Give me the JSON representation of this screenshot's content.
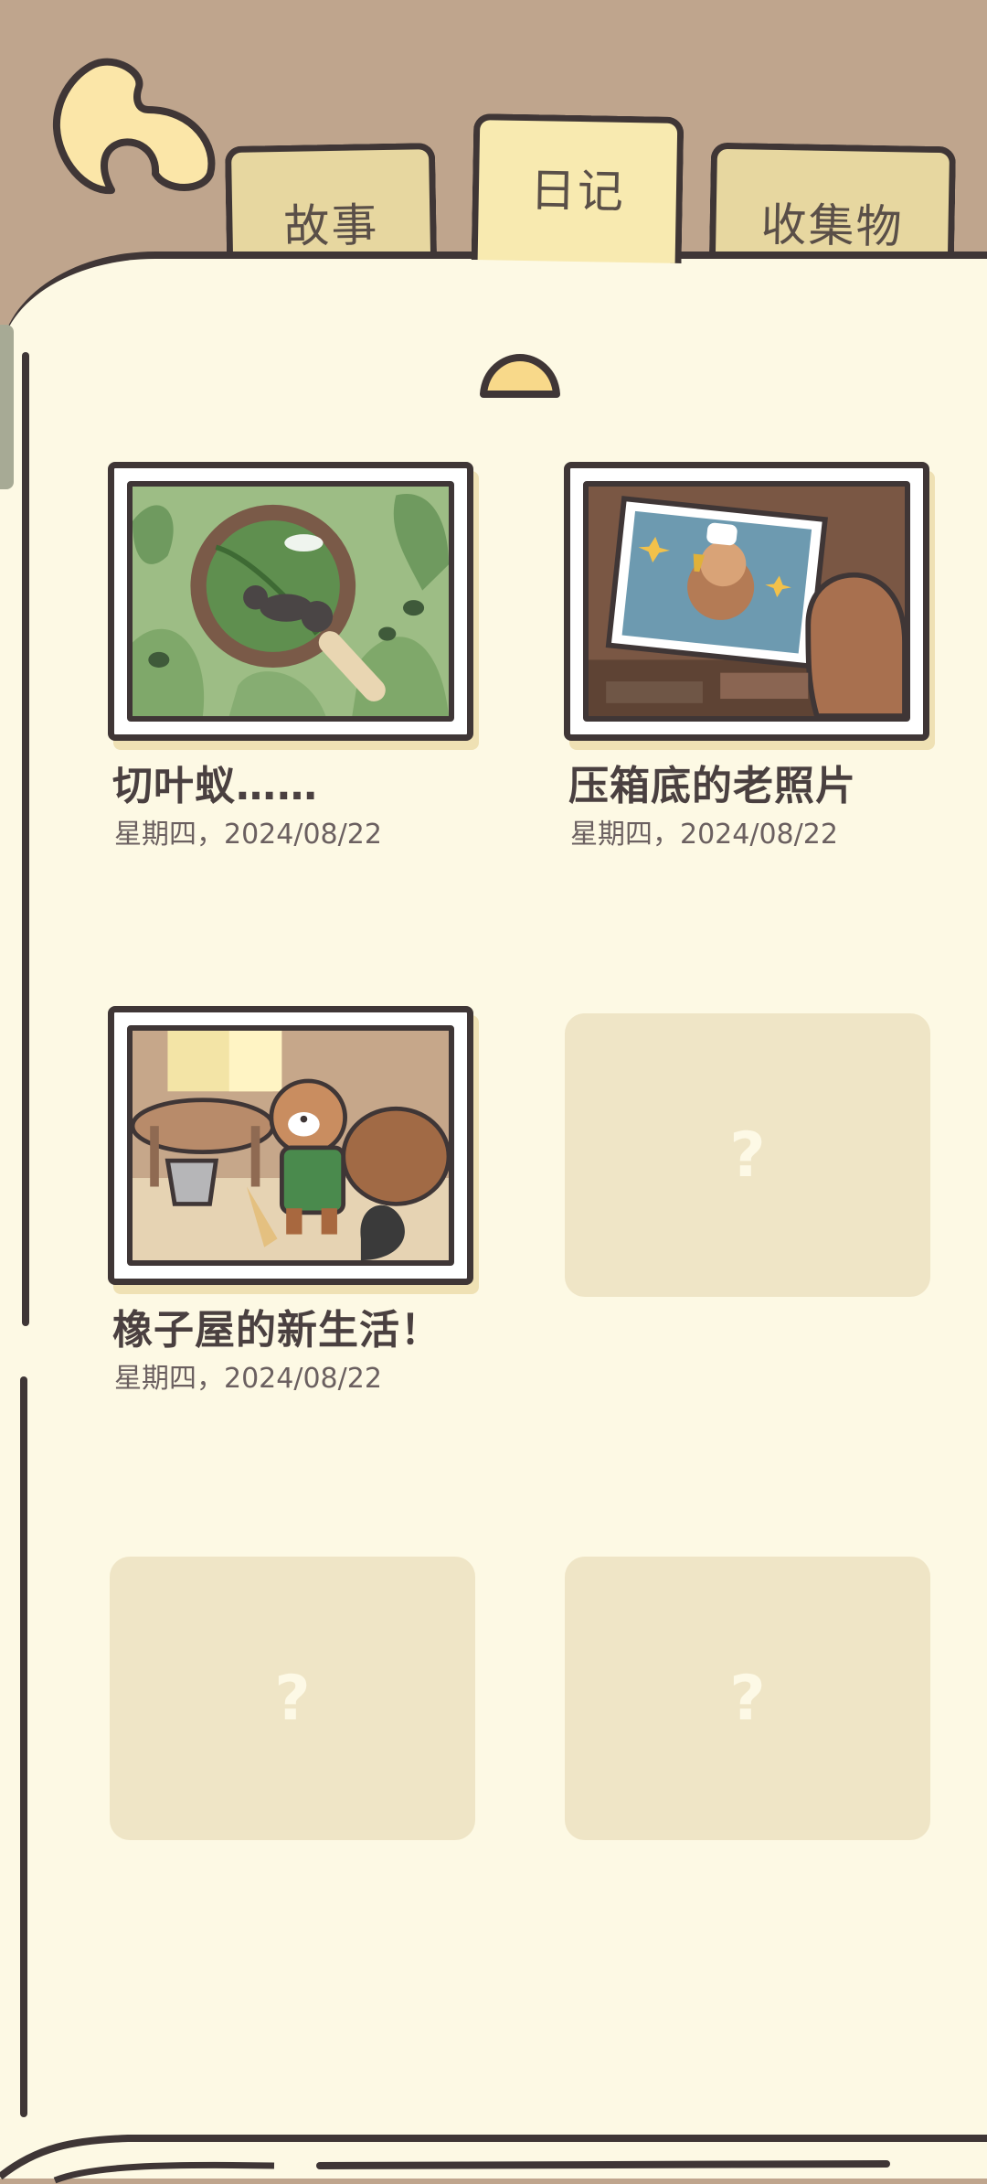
{
  "tabs": {
    "story": "故事",
    "diary": "日记",
    "collection": "收集物"
  },
  "entries": [
    {
      "title": "切叶蚁……",
      "date": "星期四，2024/08/22",
      "icon": "magnifier-ant-picture"
    },
    {
      "title": "压箱底的老照片",
      "date": "星期四，2024/08/22",
      "icon": "old-photo-picture"
    },
    {
      "title": "橡子屋的新生活！",
      "date": "星期四，2024/08/22",
      "icon": "squirrel-cleaning-picture"
    }
  ],
  "locked": [
    {
      "symbol": "?"
    },
    {
      "symbol": "?"
    },
    {
      "symbol": "?"
    }
  ],
  "colors": {
    "background": "#bfa58d",
    "page": "#fdf9e4",
    "tab_active": "#f8eab0",
    "tab_inactive": "#e7d7a0",
    "outline": "#3f3636",
    "locked_card": "#efe5c6"
  }
}
